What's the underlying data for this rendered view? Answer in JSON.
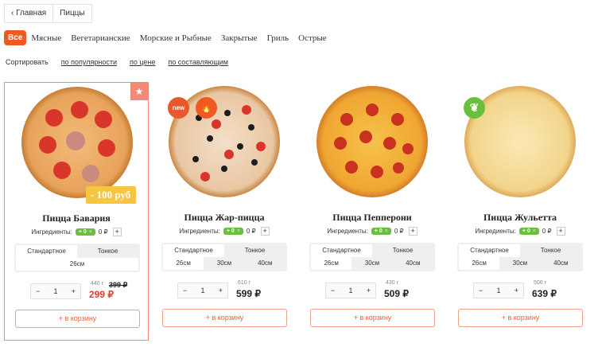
{
  "breadcrumb": {
    "back": "‹ Главная",
    "current": "Пиццы"
  },
  "categories": [
    "Все",
    "Мясные",
    "Вегетарианские",
    "Морские и Рыбные",
    "Закрытые",
    "Гриль",
    "Острые"
  ],
  "sort": {
    "label": "Сортировать",
    "options": [
      "по популярности",
      "по цене",
      "по составляющим"
    ]
  },
  "common": {
    "ingredients_label": "Ингредиенты:",
    "ingr_tag": "+ 0",
    "ingr_price": "0 ₽",
    "dough": [
      "Стандартное",
      "Тонкое"
    ],
    "cart": "+ в корзину",
    "minus": "−",
    "plus": "+"
  },
  "products": [
    {
      "name": "Пицца Бавария",
      "sizes": [
        "26см"
      ],
      "qty": "1",
      "weight": "440 г",
      "old_price": "399 ₽",
      "price": "299 ₽",
      "discount": "- 100 руб",
      "star": "★"
    },
    {
      "name": "Пицца Жар-пицца",
      "sizes": [
        "26см",
        "30см",
        "40см"
      ],
      "qty": "1",
      "weight": "610 г",
      "price": "599 ₽",
      "badge_new": "new",
      "badge_hot": "🔥"
    },
    {
      "name": "Пицца Пепперони",
      "sizes": [
        "26см",
        "30см",
        "40см"
      ],
      "qty": "1",
      "weight": "430 г",
      "price": "509 ₽"
    },
    {
      "name": "Пицца Жульетта",
      "sizes": [
        "26см",
        "30см",
        "40см"
      ],
      "qty": "1",
      "weight": "500 г",
      "price": "639 ₽",
      "badge_veg": "❦"
    }
  ],
  "colors": {
    "accent": "#ee5a24",
    "green": "#6cbe3f",
    "sale": "#e63b2e"
  }
}
